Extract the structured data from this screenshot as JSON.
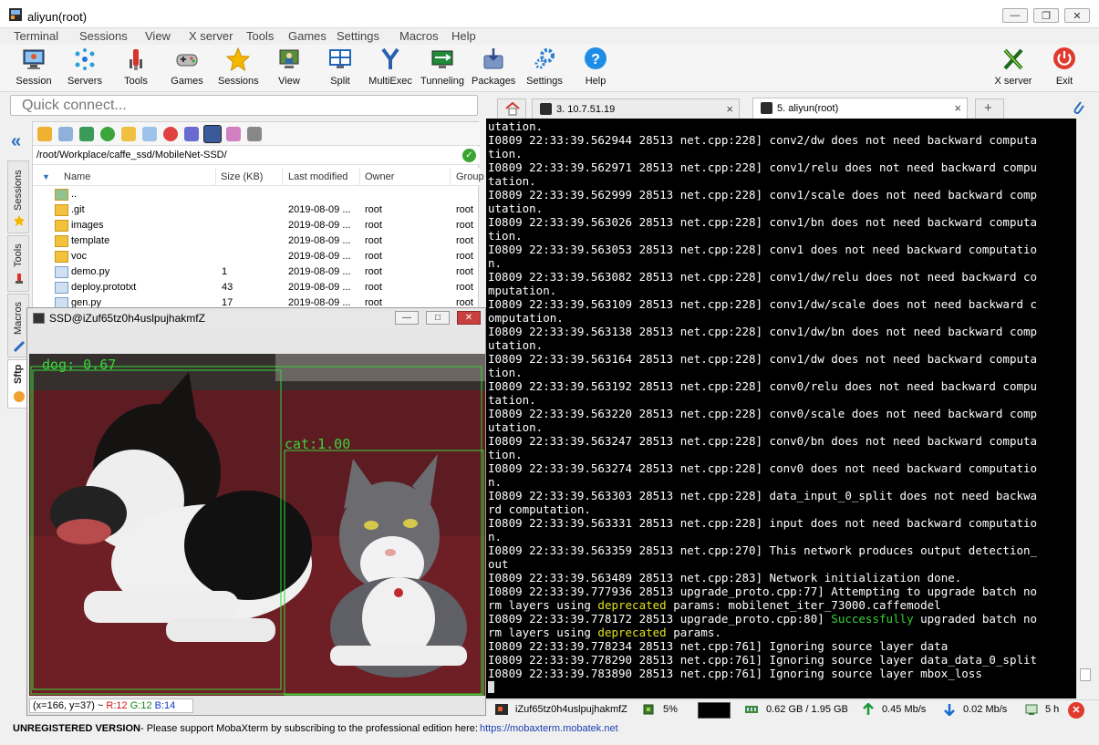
{
  "window": {
    "title": "aliyun(root)"
  },
  "menu": [
    "Terminal",
    "Sessions",
    "View",
    "X server",
    "Tools",
    "Games",
    "Settings",
    "Macros",
    "Help"
  ],
  "toolbar": {
    "items": [
      "Session",
      "Servers",
      "Tools",
      "Games",
      "Sessions",
      "View",
      "Split",
      "MultiExec",
      "Tunneling",
      "Packages",
      "Settings",
      "Help"
    ],
    "right": [
      "X server",
      "Exit"
    ]
  },
  "quick_connect": {
    "placeholder": "Quick connect..."
  },
  "left_tabs": [
    "Sessions",
    "Tools",
    "Macros",
    "Sftp"
  ],
  "sftp": {
    "path": "/root/Workplace/caffe_ssd/MobileNet-SSD/",
    "columns": [
      "Name",
      "Size (KB)",
      "Last modified",
      "Owner",
      "Group"
    ],
    "rows": [
      {
        "name": "..",
        "size": "",
        "modified": "",
        "owner": "",
        "group": ""
      },
      {
        "name": ".git",
        "size": "",
        "modified": "2019-08-09 ...",
        "owner": "root",
        "group": "root"
      },
      {
        "name": "images",
        "size": "",
        "modified": "2019-08-09 ...",
        "owner": "root",
        "group": "root"
      },
      {
        "name": "template",
        "size": "",
        "modified": "2019-08-09 ...",
        "owner": "root",
        "group": "root"
      },
      {
        "name": "voc",
        "size": "",
        "modified": "2019-08-09 ...",
        "owner": "root",
        "group": "root"
      },
      {
        "name": "demo.py",
        "size": "1",
        "modified": "2019-08-09 ...",
        "owner": "root",
        "group": "root"
      },
      {
        "name": "deploy.prototxt",
        "size": "43",
        "modified": "2019-08-09 ...",
        "owner": "root",
        "group": "root"
      },
      {
        "name": "gen.py",
        "size": "17",
        "modified": "2019-08-09 ...",
        "owner": "root",
        "group": "root"
      }
    ]
  },
  "viewer": {
    "title": "SSD@iZuf65tz0h4uslpujhakmfZ",
    "detections": [
      {
        "label": "dog: 0.67"
      },
      {
        "label": "cat:1.00"
      }
    ],
    "status": {
      "coords": "(x=166, y=37) ~",
      "r": "R:12",
      "g": "G:12",
      "b": "B:14"
    }
  },
  "tabs": [
    {
      "label": "3. 10.7.51.19"
    },
    {
      "label": "5. aliyun(root)"
    }
  ],
  "terminal": {
    "lines": [
      "utation.",
      "I0809 22:33:39.562944 28513 net.cpp:228] conv2/dw does not need backward computa",
      "tion.",
      "I0809 22:33:39.562971 28513 net.cpp:228] conv1/relu does not need backward compu",
      "tation.",
      "I0809 22:33:39.562999 28513 net.cpp:228] conv1/scale does not need backward comp",
      "utation.",
      "I0809 22:33:39.563026 28513 net.cpp:228] conv1/bn does not need backward computa",
      "tion.",
      "I0809 22:33:39.563053 28513 net.cpp:228] conv1 does not need backward computatio",
      "n.",
      "I0809 22:33:39.563082 28513 net.cpp:228] conv1/dw/relu does not need backward co",
      "mputation.",
      "I0809 22:33:39.563109 28513 net.cpp:228] conv1/dw/scale does not need backward c",
      "omputation.",
      "I0809 22:33:39.563138 28513 net.cpp:228] conv1/dw/bn does not need backward comp",
      "utation.",
      "I0809 22:33:39.563164 28513 net.cpp:228] conv1/dw does not need backward computa",
      "tion.",
      "I0809 22:33:39.563192 28513 net.cpp:228] conv0/relu does not need backward compu",
      "tation.",
      "I0809 22:33:39.563220 28513 net.cpp:228] conv0/scale does not need backward comp",
      "utation.",
      "I0809 22:33:39.563247 28513 net.cpp:228] conv0/bn does not need backward computa",
      "tion.",
      "I0809 22:33:39.563274 28513 net.cpp:228] conv0 does not need backward computatio",
      "n.",
      "I0809 22:33:39.563303 28513 net.cpp:228] data_input_0_split does not need backwa",
      "rd computation.",
      "I0809 22:33:39.563331 28513 net.cpp:228] input does not need backward computatio",
      "n.",
      "I0809 22:33:39.563359 28513 net.cpp:270] This network produces output detection_",
      "out",
      "I0809 22:33:39.563489 28513 net.cpp:283] Network initialization done.",
      "I0809 22:33:39.777936 28513 upgrade_proto.cpp:77] Attempting to upgrade batch no"
    ],
    "l36_pre": "rm layers using ",
    "l36_hl": "deprecated",
    "l36_post": " params: mobilenet_iter_73000.caffemodel",
    "l37_pre": "I0809 22:33:39.778172 28513 upgrade_proto.cpp:80] ",
    "l37_hl": "Successfully",
    "l37_post": " upgraded batch no",
    "l38_pre": "rm layers using ",
    "l38_hl": "deprecated",
    "l38_post": " params.",
    "tail": [
      "I0809 22:33:39.778234 28513 net.cpp:761] Ignoring source layer data",
      "I0809 22:33:39.778290 28513 net.cpp:761] Ignoring source layer data_data_0_split",
      "I0809 22:33:39.783890 28513 net.cpp:761] Ignoring source layer mbox_loss"
    ]
  },
  "status_bar": {
    "host": "iZuf65tz0h4uslpujhakmfZ",
    "cpu": "5%",
    "memory": "0.62 GB / 1.95 GB",
    "upload": "0.45 Mb/s",
    "download": "0.02 Mb/s",
    "uptime": "5 h"
  },
  "footer": {
    "unregistered": "UNREGISTERED VERSION",
    "message": "-  Please support MobaXterm by subscribing to the professional edition here:",
    "link": "https://mobaxterm.mobatek.net"
  },
  "colors": {
    "accent": "#1a5fb4",
    "terminal_bg": "#000000",
    "highlight_yellow": "#e3e31f",
    "highlight_green": "#35d335",
    "bbox_green": "#3ad43a"
  }
}
